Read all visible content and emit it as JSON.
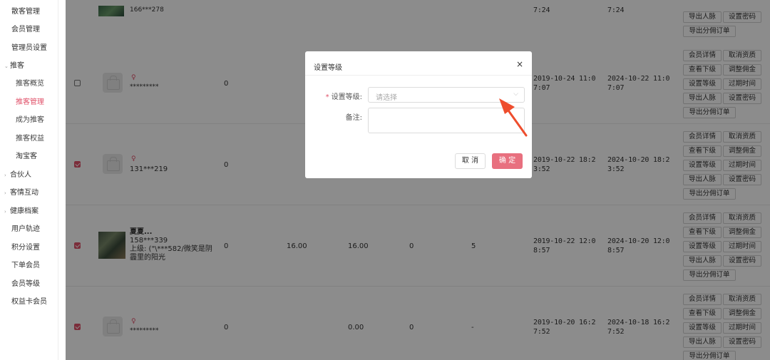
{
  "sidebar": {
    "items": [
      {
        "label": "散客管理"
      },
      {
        "label": "会员管理"
      },
      {
        "label": "管理员设置"
      },
      {
        "label": "推客",
        "arrow": "⌄"
      },
      {
        "label": "推客概览"
      },
      {
        "label": "推客管理"
      },
      {
        "label": "成为推客"
      },
      {
        "label": "推客权益"
      },
      {
        "label": "淘宝客"
      },
      {
        "label": "合伙人",
        "arrow": "›"
      },
      {
        "label": "客情互动",
        "arrow": "›"
      },
      {
        "label": "健康档案",
        "arrow": "›"
      },
      {
        "label": "用户轨迹"
      },
      {
        "label": "积分设置"
      },
      {
        "label": "下单会员"
      },
      {
        "label": "会员等级"
      },
      {
        "label": "权益卡会员"
      }
    ],
    "active_color": "#e0526a"
  },
  "table": {
    "action_buttons": {
      "detail": "会员详情",
      "cancel_qual": "取消资质",
      "view_sub": "查看下级",
      "adjust_comm": "调整佣金",
      "set_level": "设置等级",
      "expire_time": "过期时间",
      "export_network": "导出人脉",
      "set_password": "设置密码",
      "export_orders": "导出分佣订单"
    },
    "top_partial_row": {
      "phone": "166***278",
      "date1": "7:24",
      "date2": "7:24"
    },
    "rows": [
      {
        "checked": false,
        "gender": "♀",
        "phone": "*********",
        "v1": "0",
        "date1": "2019-10-24 11:07:07",
        "date2": "2024-10-22 11:07:07"
      },
      {
        "checked": true,
        "gender": "♀",
        "phone": "131***219",
        "v1": "0",
        "date1": "2019-10-22 18:23:52",
        "date2": "2024-10-20 18:23:52"
      },
      {
        "checked": true,
        "name": "夏夏...",
        "phone": "158***339",
        "superior": "上级: (\"\\***582/微笑是阴霾里的阳光",
        "v1": "0",
        "v2": "16.00",
        "v3": "16.00",
        "v4": "0",
        "v5": "5",
        "date1": "2019-10-22 12:08:57",
        "date2": "2024-10-20 12:08:57"
      },
      {
        "checked": true,
        "gender": "♀",
        "phone": "*********",
        "v1": "0",
        "v3": "0.00",
        "v4": "0",
        "v5": "-",
        "date1": "2019-10-20 16:27:52",
        "date2": "2024-10-18 16:27:52"
      }
    ]
  },
  "dialog": {
    "title": "设置等级",
    "close": "×",
    "level_label": "设置等级:",
    "level_required": "*",
    "level_placeholder": "请选择",
    "remark_label": "备注:",
    "cancel_label": "取 消",
    "ok_label": "确 定"
  }
}
